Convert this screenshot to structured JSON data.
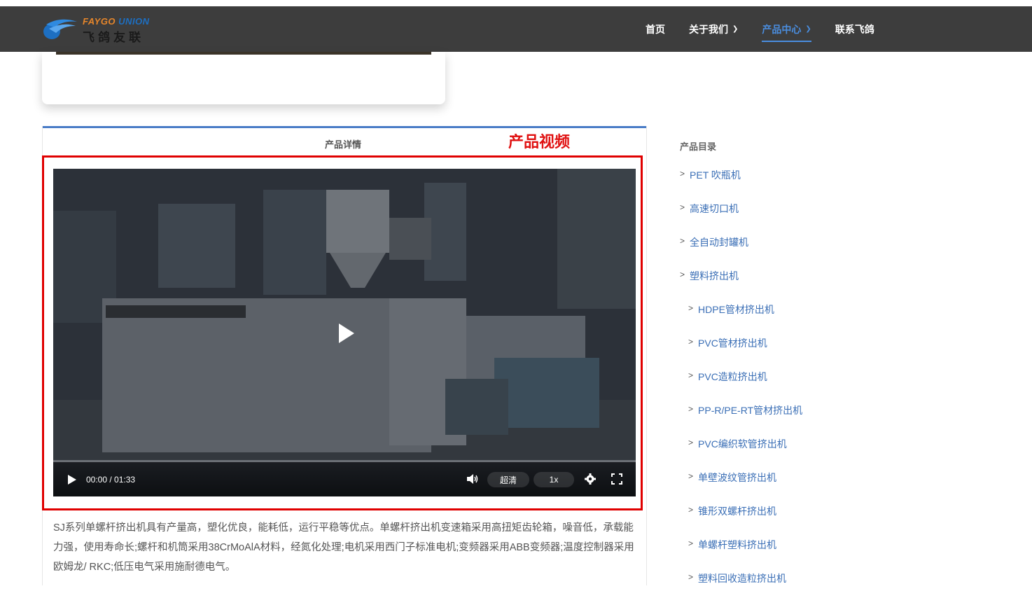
{
  "header": {
    "logo_en_1": "FAYGO",
    "logo_en_2": "UNION",
    "logo_cn": "飞鸽友联",
    "nav": [
      {
        "label": "首页",
        "has_dropdown": false,
        "active": false
      },
      {
        "label": "关于我们",
        "has_dropdown": true,
        "active": false
      },
      {
        "label": "产品中心",
        "has_dropdown": true,
        "active": true
      },
      {
        "label": "联系飞鸽",
        "has_dropdown": false,
        "active": false
      }
    ]
  },
  "tabs": {
    "detail_label": "产品详情",
    "video_label": "产品视频"
  },
  "video": {
    "time": "00:00 / 01:33",
    "quality": "超清",
    "speed": "1x",
    "progress": 0
  },
  "description": "SJ系列单螺杆挤出机具有产量高，塑化优良，能耗低，运行平稳等优点。单螺杆挤出机变速箱采用高扭矩齿轮箱，噪音低，承载能力强，使用寿命长;螺杆和机筒采用38CrMoAlA材料，经氮化处理;电机采用西门子标准电机;变频器采用ABB变频器;温度控制器采用欧姆龙/ RKC;低压电气采用施耐德电气。",
  "sidebar": {
    "title": "产品目录",
    "items": [
      {
        "label": "PET 吹瓶机",
        "sub": false
      },
      {
        "label": "高速切口机",
        "sub": false
      },
      {
        "label": "全自动封罐机",
        "sub": false
      },
      {
        "label": "塑料挤出机",
        "sub": false
      },
      {
        "label": "HDPE管材挤出机",
        "sub": true
      },
      {
        "label": "PVC管材挤出机",
        "sub": true
      },
      {
        "label": "PVC造粒挤出机",
        "sub": true
      },
      {
        "label": "PP-R/PE-RT管材挤出机",
        "sub": true
      },
      {
        "label": "PVC编织软管挤出机",
        "sub": true
      },
      {
        "label": "单壁波纹管挤出机",
        "sub": true
      },
      {
        "label": "锥形双螺杆挤出机",
        "sub": true
      },
      {
        "label": "单螺杆塑料挤出机",
        "sub": true
      },
      {
        "label": "塑料回收造粒挤出机",
        "sub": true
      }
    ]
  },
  "colors": {
    "header_bg": "#3d3d3d",
    "accent": "#4a8ee0",
    "link": "#3b6fb6",
    "highlight_box": "#e00000"
  }
}
